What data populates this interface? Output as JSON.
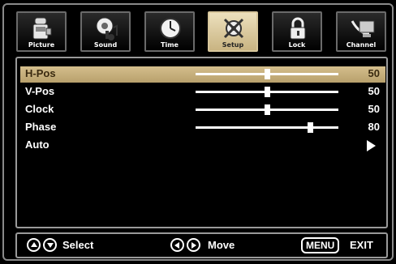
{
  "tabs": [
    {
      "label": "Picture",
      "icon": "camcorder-icon",
      "active": false
    },
    {
      "label": "Sound",
      "icon": "speaker-music-icon",
      "active": false
    },
    {
      "label": "Time",
      "icon": "clock-icon",
      "active": false
    },
    {
      "label": "Setup",
      "icon": "gear-wrench-icon",
      "active": true
    },
    {
      "label": "Lock",
      "icon": "padlock-icon",
      "active": false
    },
    {
      "label": "Channel",
      "icon": "satellite-dish-icon",
      "active": false
    }
  ],
  "settings": [
    {
      "label": "H-Pos",
      "value": "50",
      "level": 50,
      "selected": true
    },
    {
      "label": "V-Pos",
      "value": "50",
      "level": 50,
      "selected": false
    },
    {
      "label": "Clock",
      "value": "50",
      "level": 50,
      "selected": false
    },
    {
      "label": "Phase",
      "value": "80",
      "level": 80,
      "selected": false
    },
    {
      "label": "Auto",
      "value": "",
      "type": "submenu-arrow",
      "selected": false
    }
  ],
  "footer": {
    "select_label": "Select",
    "move_label": "Move",
    "menu_key": "MENU",
    "exit_label": "EXIT"
  },
  "colors": {
    "active_tab": "#d8c79c",
    "selected_row": "#c9b07c",
    "border": "#9a9a9a"
  }
}
